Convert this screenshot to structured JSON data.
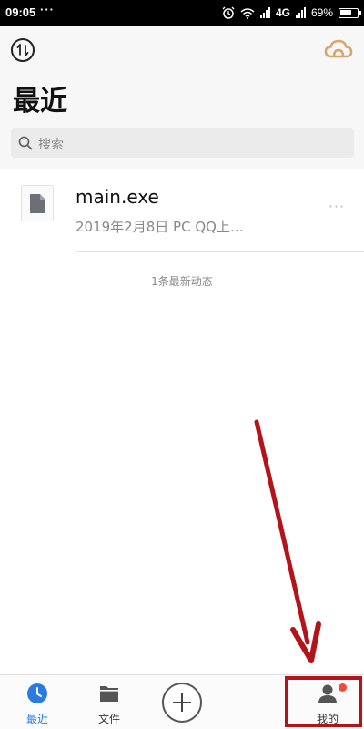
{
  "status_bar": {
    "time": "09:05",
    "dots": "···",
    "network": "4G",
    "battery_percent": "69%",
    "battery_level": 0.69,
    "icons": [
      "alarm-icon",
      "wifi-icon",
      "signal-icon",
      "signal-icon",
      "battery-icon"
    ]
  },
  "header": {
    "sort_icon": "sort-icon",
    "cloud_icon": "cloud-icon",
    "title": "最近",
    "search_placeholder": "搜索"
  },
  "files": [
    {
      "name": "main.exe",
      "meta": "2019年2月8日  PC QQ上…",
      "icon": "file-icon",
      "more": "···"
    }
  ],
  "update_count": "1条最新动态",
  "bottom_nav": {
    "items": [
      {
        "label": "最近",
        "icon": "clock-icon",
        "active": true
      },
      {
        "label": "文件",
        "icon": "folder-icon",
        "active": false
      },
      {
        "label": "",
        "icon": "add-icon",
        "active": false
      },
      {
        "label": "我的",
        "icon": "profile-icon",
        "active": false,
        "badge": true
      }
    ]
  },
  "colors": {
    "accent": "#2a7ae2",
    "annotation": "#b3141a",
    "cloud": "#d9a56a",
    "badge": "#f24a3a"
  }
}
